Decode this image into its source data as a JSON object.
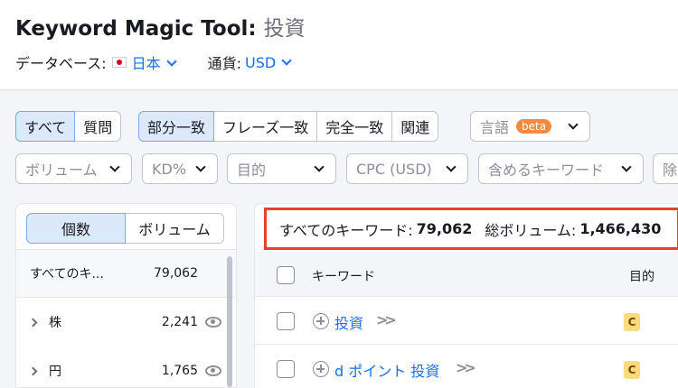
{
  "header": {
    "title": "Keyword Magic Tool:",
    "keyword": "投資",
    "database_label": "データベース:",
    "database_value": "日本",
    "currency_label": "通貨:",
    "currency_value": "USD"
  },
  "match_tabs": {
    "all": "すべて",
    "questions": "質問",
    "broad": "部分一致",
    "phrase": "フレーズ一致",
    "exact": "完全一致",
    "related": "関連"
  },
  "language": {
    "label": "言語",
    "badge": "beta"
  },
  "filters": {
    "volume": "ボリューム",
    "kd": "KD%",
    "intent": "目的",
    "cpc": "CPC (USD)",
    "include": "含めるキーワード",
    "exclude": "除"
  },
  "groups": {
    "toggle_count": "個数",
    "toggle_volume": "ボリューム",
    "rows": [
      {
        "label": "すべてのキ...",
        "count": "79,062"
      },
      {
        "label": "株",
        "count": "2,241"
      },
      {
        "label": "円",
        "count": "1,765"
      }
    ]
  },
  "summary": {
    "all_keywords_label": "すべてのキーワード:",
    "all_keywords_value": "79,062",
    "total_volume_label": "総ボリューム:",
    "total_volume_value": "1,466,430"
  },
  "table": {
    "col_keyword": "キーワード",
    "col_intent": "目的",
    "rows": [
      {
        "keyword": "投資",
        "intent": "C"
      },
      {
        "keyword": "d ポイント 投資",
        "intent": "C"
      }
    ]
  },
  "colors": {
    "accent": "#1570ef",
    "highlight": "#e8402c",
    "active_tab": "#dbe9fb"
  }
}
